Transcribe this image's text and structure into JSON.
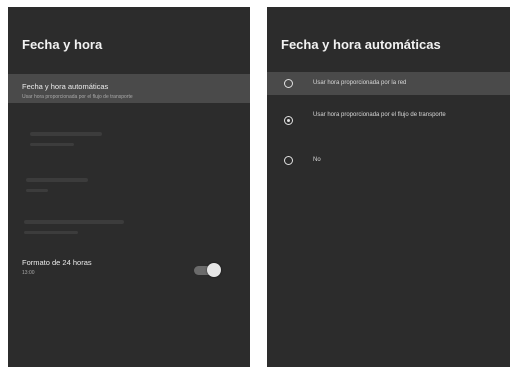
{
  "left": {
    "title": "Fecha y hora",
    "items": [
      {
        "label": "Fecha y hora automáticas",
        "sublabel": "Usar hora proporcionada por el flujo de transporte"
      }
    ],
    "format24": {
      "label": "Formato de 24 horas",
      "value": "13:00"
    }
  },
  "right": {
    "title": "Fecha y hora automáticas",
    "options": [
      {
        "label": "Usar hora proporcionada por la red",
        "selected": false
      },
      {
        "label": "Usar hora proporcionada por el flujo de transporte",
        "selected": true
      },
      {
        "label": "No",
        "selected": false
      }
    ]
  },
  "colors": {
    "panel_bg": "#2c2c2c",
    "highlight_bg": "#4a4a4a",
    "text_primary": "#ececec",
    "text_secondary": "#a9a9a9"
  }
}
